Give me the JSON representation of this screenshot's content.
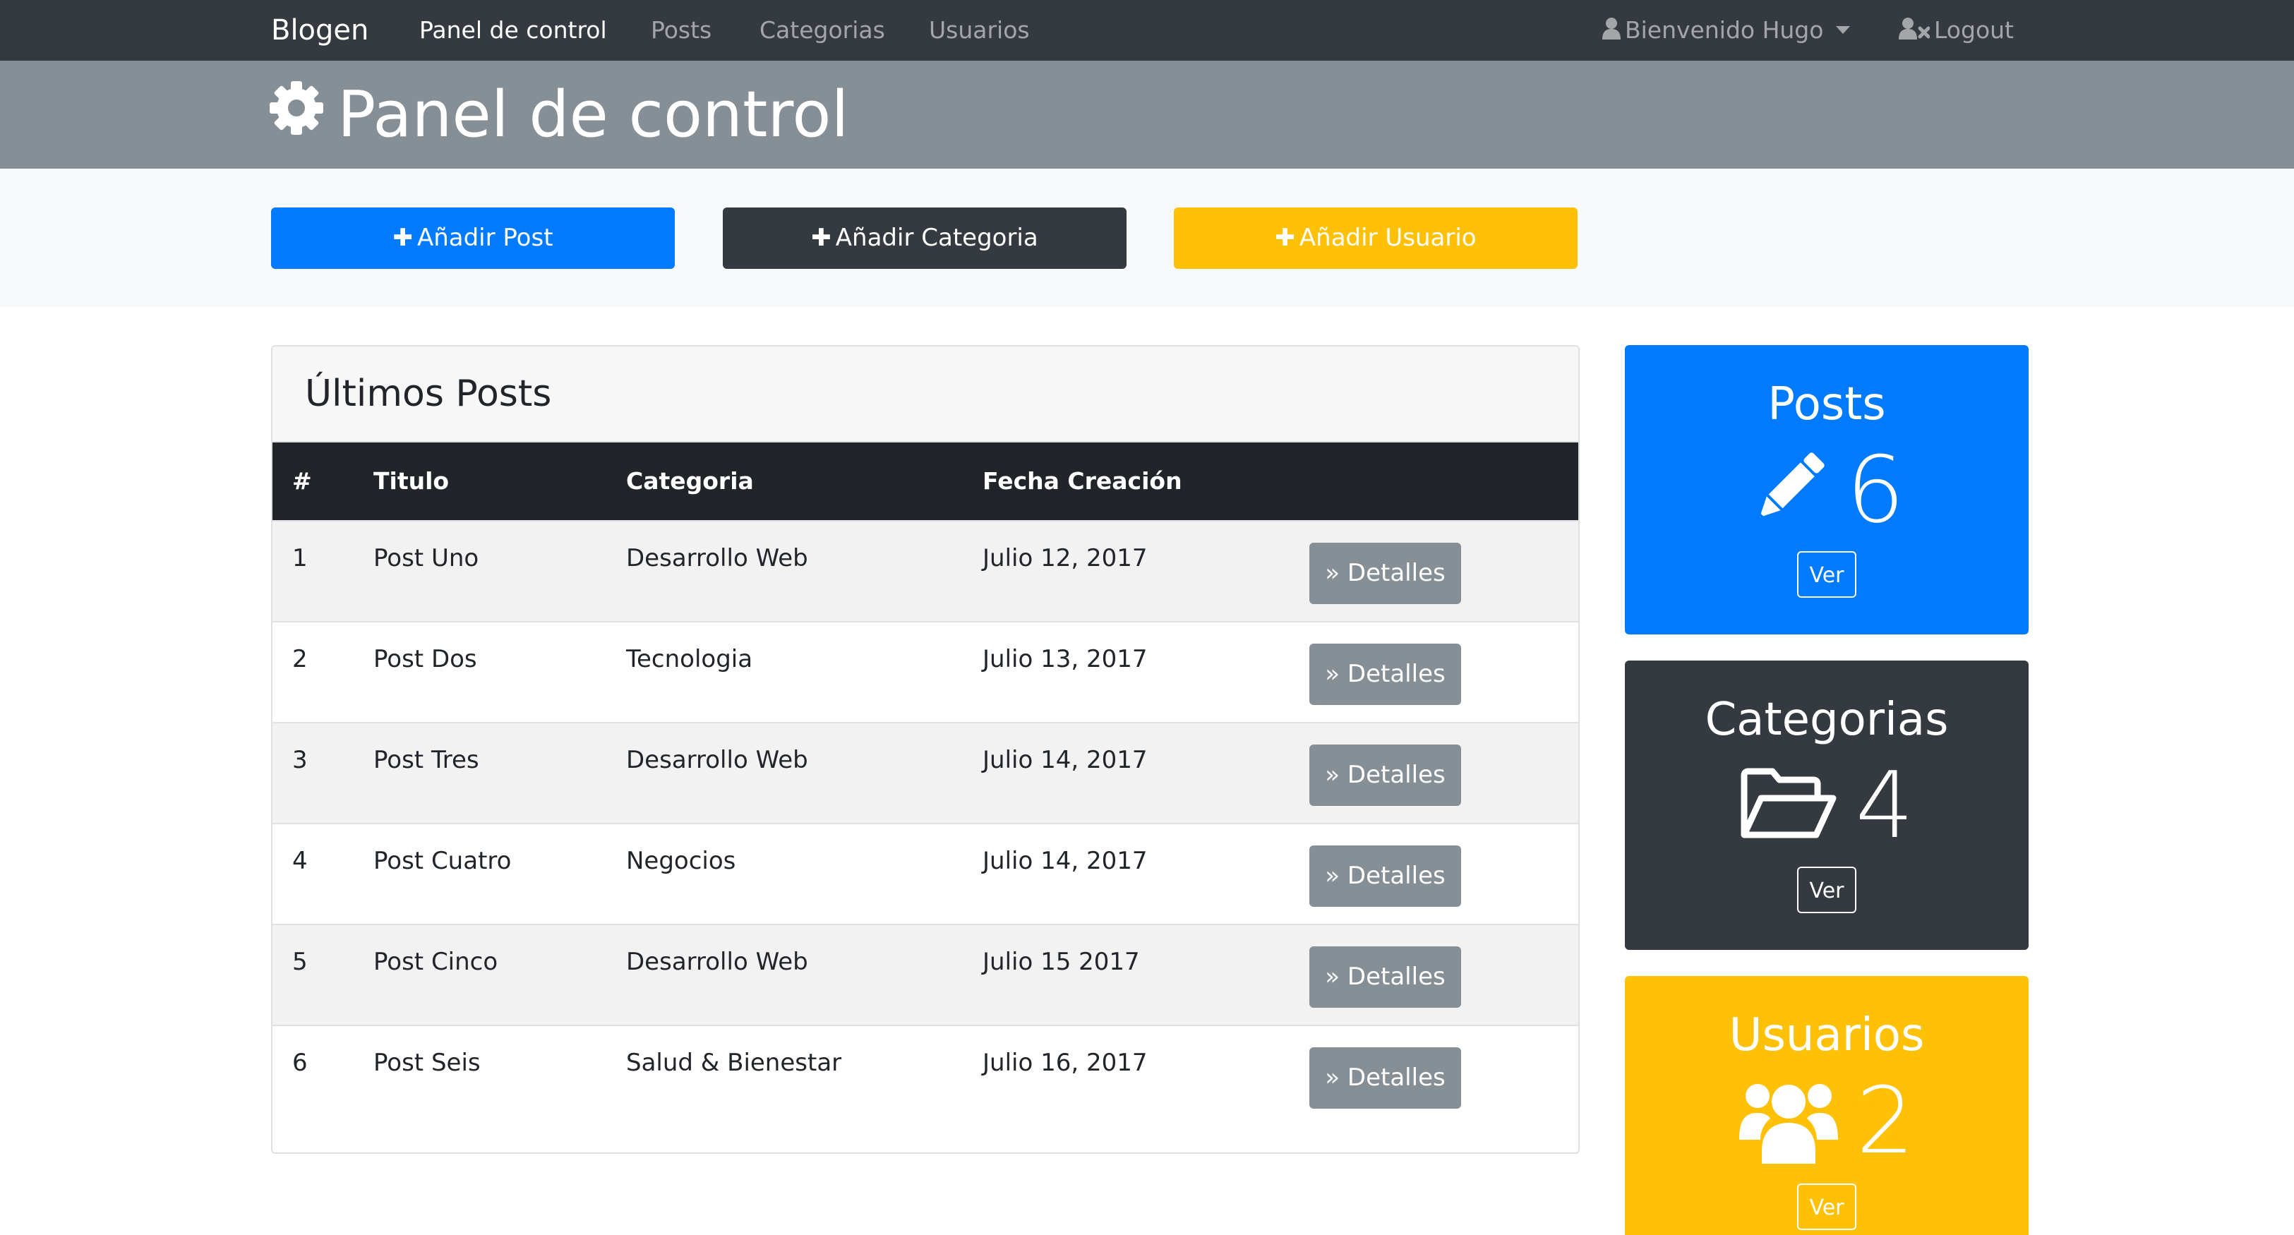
{
  "navbar": {
    "brand": "Blogen",
    "links": [
      {
        "label": "Panel de control",
        "active": true
      },
      {
        "label": "Posts",
        "active": false
      },
      {
        "label": "Categorias",
        "active": false
      },
      {
        "label": "Usuarios",
        "active": false
      }
    ],
    "user_menu_label": "Bienvenido Hugo",
    "logout_label": "Logout"
  },
  "header": {
    "title": "Panel de control",
    "icon": "gear-icon"
  },
  "actions": {
    "add_post": "Añadir Post",
    "add_category": "Añadir Categoria",
    "add_user": "Añadir Usuario"
  },
  "latest_posts": {
    "title": "Últimos Posts",
    "columns": [
      "#",
      "Titulo",
      "Categoria",
      "Fecha Creación"
    ],
    "details_label": "Detalles",
    "rows": [
      {
        "num": "1",
        "title": "Post Uno",
        "category": "Desarrollo Web",
        "date": "Julio 12, 2017"
      },
      {
        "num": "2",
        "title": "Post Dos",
        "category": "Tecnologia",
        "date": "Julio 13, 2017"
      },
      {
        "num": "3",
        "title": "Post Tres",
        "category": "Desarrollo Web",
        "date": "Julio 14, 2017"
      },
      {
        "num": "4",
        "title": "Post Cuatro",
        "category": "Negocios",
        "date": "Julio 14, 2017"
      },
      {
        "num": "5",
        "title": "Post Cinco",
        "category": "Desarrollo Web",
        "date": "Julio 15 2017"
      },
      {
        "num": "6",
        "title": "Post Seis",
        "category": "Salud & Bienestar",
        "date": "Julio 16, 2017"
      }
    ]
  },
  "stats": {
    "posts": {
      "title": "Posts",
      "count": "6",
      "button": "Ver",
      "icon": "pencil-icon",
      "color": "#007bff"
    },
    "categories": {
      "title": "Categorias",
      "count": "4",
      "button": "Ver",
      "icon": "folder-open-icon",
      "color": "#343a40"
    },
    "users": {
      "title": "Usuarios",
      "count": "2",
      "button": "Ver",
      "icon": "users-icon",
      "color": "#ffc107"
    }
  }
}
